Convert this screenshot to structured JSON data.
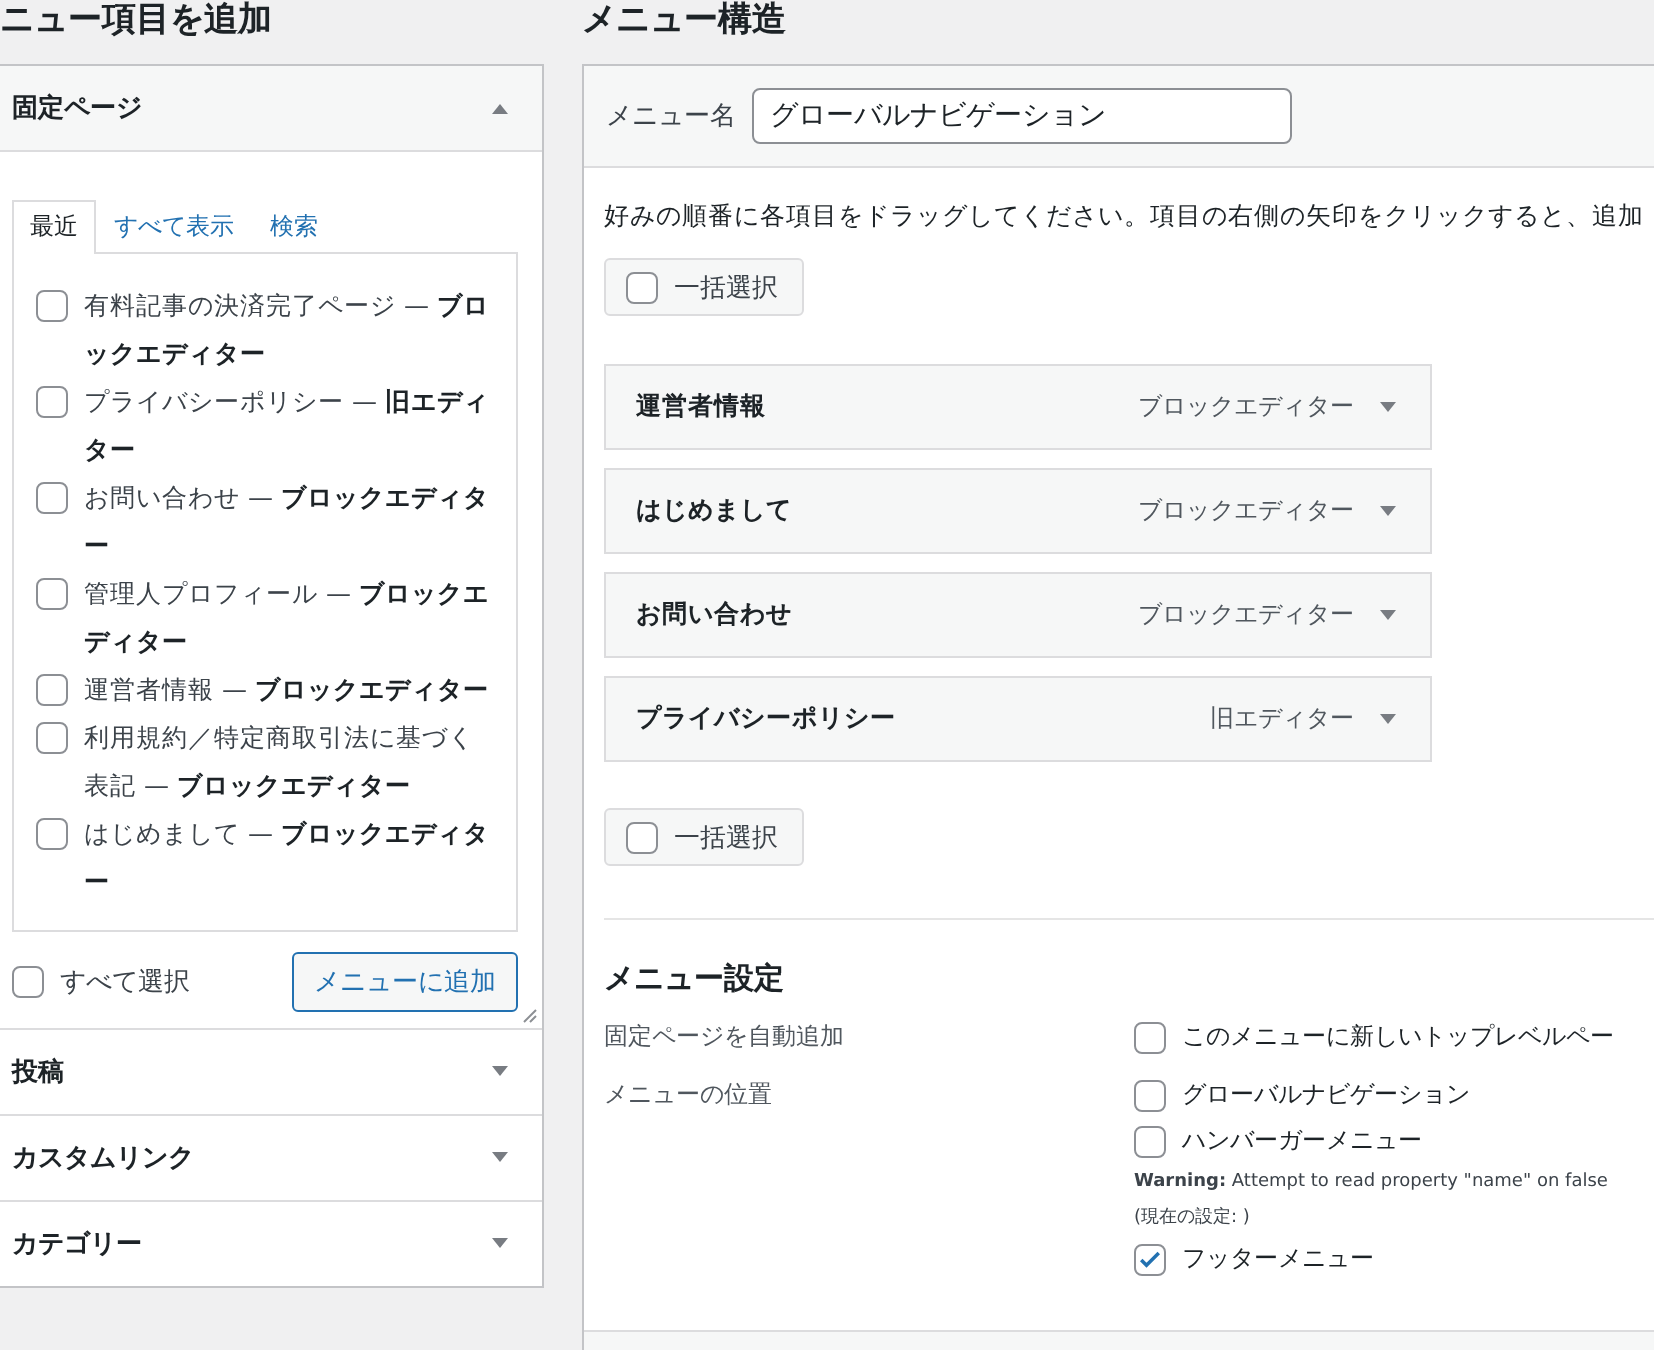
{
  "left_heading": "ニュー項目を追加",
  "pages_section": {
    "title": "固定ページ",
    "expanded": true,
    "tabs": [
      {
        "label": "最近",
        "selected": true
      },
      {
        "label": "すべて表示",
        "selected": false
      },
      {
        "label": "検索",
        "selected": false
      }
    ],
    "items": [
      {
        "label": "有料記事の決済完了ページ — **ブロックエディター**",
        "checked": false
      },
      {
        "label": "プライバシーポリシー — **旧エディター**",
        "checked": false
      },
      {
        "label": "お問い合わせ — **ブロックエディター**",
        "checked": false
      },
      {
        "label": "管理人プロフィール — **ブロックエディター**",
        "checked": false
      },
      {
        "label": "運営者情報 — **ブロックエディター**",
        "checked": false
      },
      {
        "label": "利用規約／特定商取引法に基づく表記 — **ブロックエディター**",
        "checked": false
      },
      {
        "label": "はじめまして — **ブロックエディター**",
        "checked": false
      }
    ],
    "select_all": {
      "label": "すべて選択",
      "checked": false
    },
    "add_button": "メニューに追加"
  },
  "other_sections": [
    {
      "title": "投稿",
      "expanded": false
    },
    {
      "title": "カスタムリンク",
      "expanded": false
    },
    {
      "title": "カテゴリー",
      "expanded": false
    }
  ],
  "structure": {
    "heading": "メニュー構造",
    "name_label": "メニュー名",
    "name_value": "グローバルナビゲーション",
    "instructions": "好みの順番に各項目をドラッグしてください。項目の右側の矢印をクリックすると、追加",
    "bulk_select": [
      {
        "label": "一括選択",
        "checked": false
      },
      {
        "label": "一括選択",
        "checked": false
      }
    ],
    "items": [
      {
        "title": "運営者情報",
        "type": "ブロックエディター"
      },
      {
        "title": "はじめまして",
        "type": "ブロックエディター"
      },
      {
        "title": "お問い合わせ",
        "type": "ブロックエディター"
      },
      {
        "title": "プライバシーポリシー",
        "type": "旧エディター"
      }
    ]
  },
  "settings": {
    "heading": "メニュー設定",
    "rows": [
      {
        "label": "固定ページを自動追加",
        "options": [
          {
            "kind": "checkbox",
            "label": "このメニューに新しいトップレベルペー",
            "checked": false
          }
        ]
      },
      {
        "label": "メニューの位置",
        "options": [
          {
            "kind": "checkbox",
            "label": "グローバルナビゲーション",
            "checked": false
          },
          {
            "kind": "checkbox",
            "label": "ハンバーガーメニュー",
            "checked": false
          },
          {
            "kind": "note",
            "label": "**Warning:** Attempt to read property \"name\" on false"
          },
          {
            "kind": "note",
            "label": "(現在の設定: )"
          },
          {
            "kind": "checkbox",
            "label": "フッターメニュー",
            "checked": true
          }
        ]
      }
    ]
  }
}
